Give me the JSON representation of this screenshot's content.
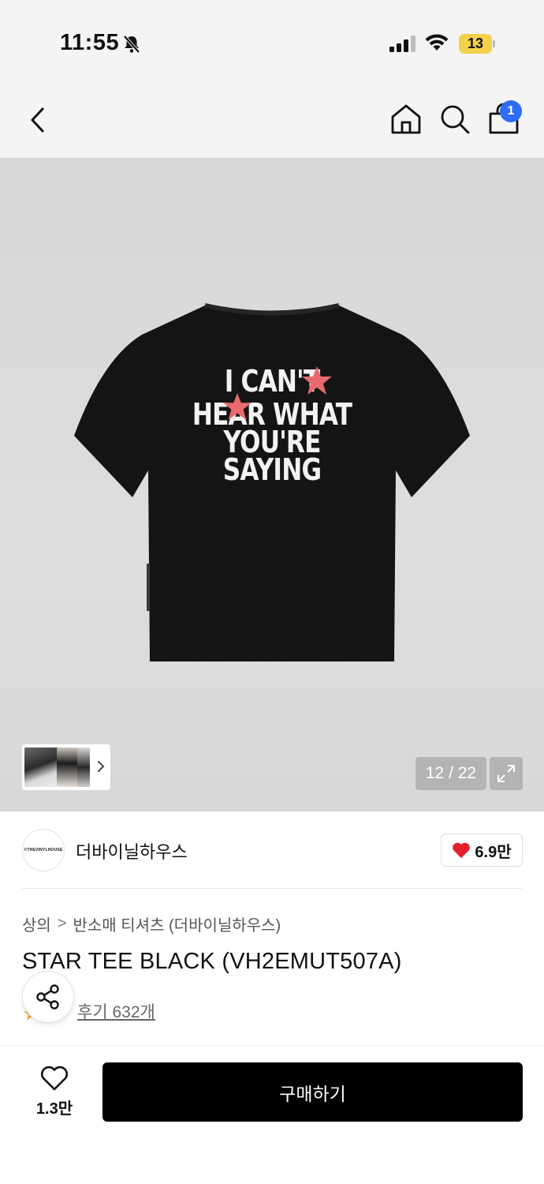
{
  "status_bar": {
    "time": "11:55",
    "battery": "13"
  },
  "nav": {
    "cart_count": "1"
  },
  "gallery": {
    "shirt_text": [
      "I CAN'T",
      "HEAR WHAT",
      "YOU'RE",
      "SAYING"
    ],
    "counter": "12 / 22"
  },
  "brand": {
    "logo_text": "©THEVINYLHOUSE",
    "name": "더바이닐하우스",
    "likes": "6.9만"
  },
  "breadcrumb": {
    "category": "상의",
    "separator": ">",
    "subcategory": "반소매 티셔츠 (더바이닐하우스)"
  },
  "product": {
    "title": "STAR TEE BLACK (VH2EMUT507A)",
    "reviews": "후기 632개"
  },
  "bottom": {
    "wish_count": "1.3만",
    "buy_label": "구매하기"
  },
  "colors": {
    "accent_badge": "#2f6cf6",
    "battery": "#f3d14a",
    "heart": "#e5202e",
    "buy_button": "#000000"
  },
  "icons": [
    "bell-slash-icon",
    "signal-icon",
    "wifi-icon",
    "battery-icon",
    "back-icon",
    "home-icon",
    "search-icon",
    "cart-icon",
    "chevron-right-icon",
    "expand-icon",
    "heart-icon",
    "share-icon",
    "star-icon"
  ]
}
